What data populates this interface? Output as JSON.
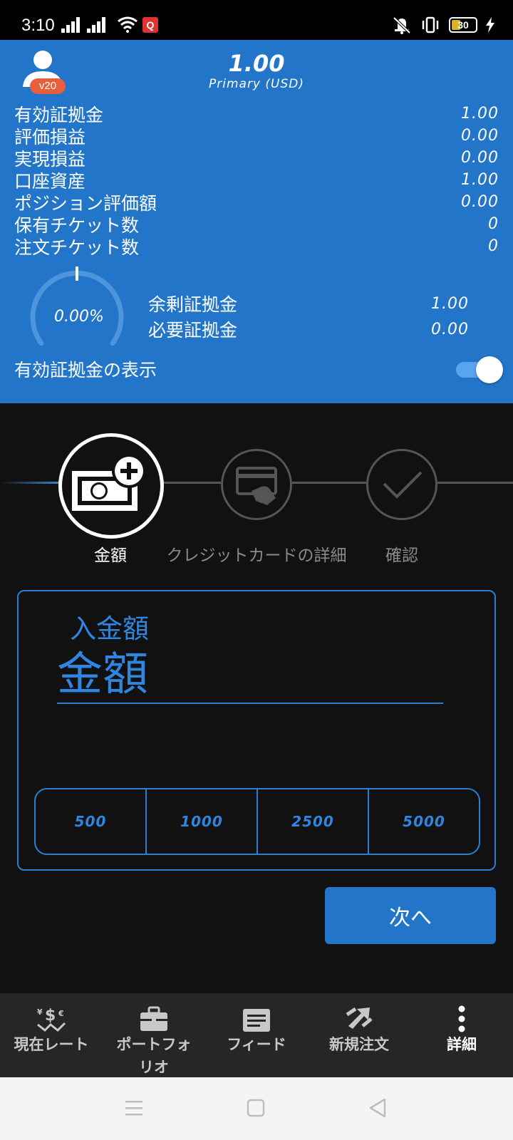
{
  "status_bar": {
    "time": "3:10",
    "notification_badge": "Q",
    "battery_level": "30"
  },
  "header": {
    "avatar_badge": "v20",
    "amount": "1.00",
    "account": "Primary (USD)"
  },
  "metrics": [
    {
      "label": "有効証拠金",
      "value": "1.00"
    },
    {
      "label": "評価損益",
      "value": "0.00"
    },
    {
      "label": "実現損益",
      "value": "0.00"
    },
    {
      "label": "口座資産",
      "value": "1.00"
    },
    {
      "label": "ポジション評価額",
      "value": "0.00"
    },
    {
      "label": "保有チケット数",
      "value": "0"
    },
    {
      "label": "注文チケット数",
      "value": "0"
    }
  ],
  "margin_gauge": {
    "percent_text": "0.00%",
    "fraction": 0.0
  },
  "margin": [
    {
      "label": "余剰証拠金",
      "value": "1.00"
    },
    {
      "label": "必要証拠金",
      "value": "0.00"
    }
  ],
  "toggle": {
    "label": "有効証拠金の表示",
    "on": true
  },
  "steps": [
    {
      "label": "金額",
      "icon": "cash-plus-icon",
      "state": "active"
    },
    {
      "label": "クレジットカードの詳細",
      "icon": "credit-card-icon",
      "state": "pending"
    },
    {
      "label": "確認",
      "icon": "checkmark-icon",
      "state": "pending"
    }
  ],
  "amount_form": {
    "label": "入金額",
    "placeholder": "金額",
    "quick_amounts": [
      "500",
      "1000",
      "2500",
      "5000"
    ]
  },
  "next_button": "次へ",
  "bottom_nav": [
    {
      "label": "現在レート",
      "icon": "currency-exchange-icon"
    },
    {
      "label": "ポートフォリオ",
      "icon": "briefcase-icon"
    },
    {
      "label": "フィード",
      "icon": "news-feed-icon"
    },
    {
      "label": "新規注文",
      "icon": "new-order-arrows-icon"
    },
    {
      "label": "詳細",
      "icon": "more-vertical-icon",
      "active": true
    }
  ],
  "colors": {
    "accent_blue": "#2275c8",
    "text_blue": "#2f86e0",
    "badge_orange": "#e85f3c",
    "background": "#111111"
  }
}
